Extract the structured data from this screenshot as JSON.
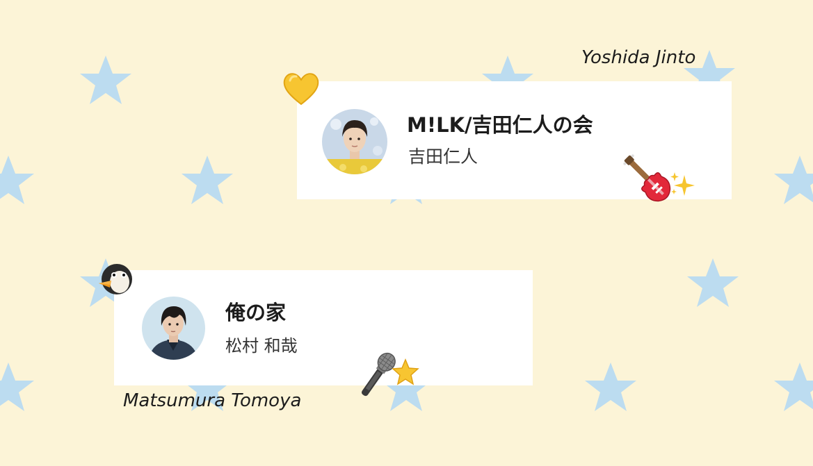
{
  "background": {
    "color": "#fcf4d7",
    "pattern": "star-icon",
    "star_color": "#bcdcf0"
  },
  "cards": [
    {
      "title": "M!LK/吉田仁人の会",
      "subtitle": "吉田仁人",
      "caption": "Yoshida Jinto",
      "avatar": "avatar-photo",
      "decorations": [
        "yellow-heart-icon",
        "guitar-icon",
        "sparkles-icon"
      ]
    },
    {
      "title": "俺の家",
      "subtitle": "松村 和哉",
      "caption": "Matsumura Tomoya",
      "avatar": "avatar-photo",
      "decorations": [
        "penguin-icon",
        "microphone-icon",
        "star-icon"
      ]
    }
  ]
}
